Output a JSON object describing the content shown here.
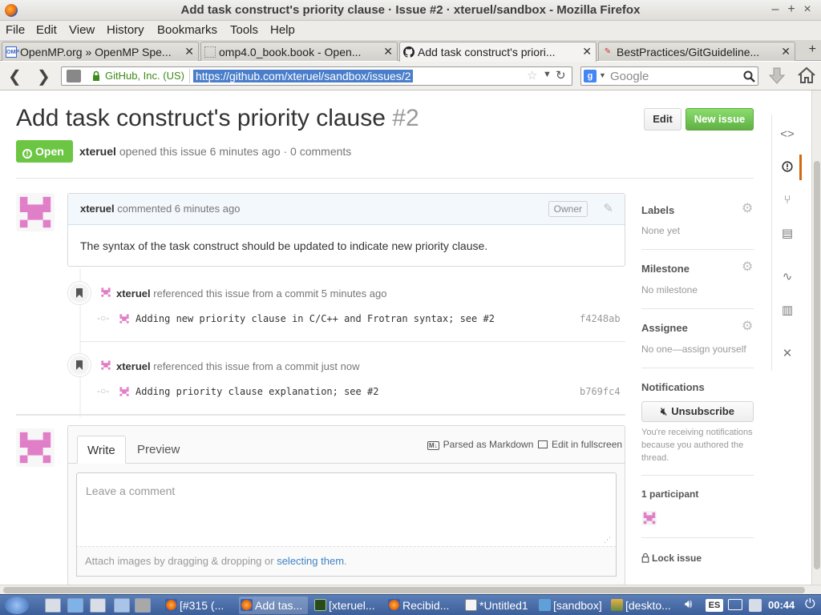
{
  "window": {
    "title": "Add task construct's priority clause · Issue #2 · xteruel/sandbox - Mozilla Firefox",
    "minimize": "–",
    "maximize": "+",
    "close": "×"
  },
  "menu": [
    "File",
    "Edit",
    "View",
    "History",
    "Bookmarks",
    "Tools",
    "Help"
  ],
  "tabs": [
    {
      "label": "OpenMP.org » OpenMP Spe...",
      "favicon": "OMP"
    },
    {
      "label": "omp4.0_book.book - Open...",
      "favicon": ""
    },
    {
      "label": "Add task construct's priori...",
      "favicon": "github"
    },
    {
      "label": "BestPractices/GitGuideline...",
      "favicon": ""
    }
  ],
  "newtab": "+",
  "nav": {
    "identity": "GitHub, Inc. (US)",
    "url": "https://github.com/xteruel/sandbox/issues/2",
    "search_engine": "g",
    "search_placeholder": "Google"
  },
  "issue": {
    "title": "Add task construct's priority clause",
    "number": "#2",
    "edit_label": "Edit",
    "new_issue_label": "New issue",
    "state": "Open",
    "author": "xteruel",
    "meta": "opened this issue 6 minutes ago · 0 comments"
  },
  "comment": {
    "author": "xteruel",
    "when": "commented 6 minutes ago",
    "badge": "Owner",
    "body": "The syntax of the task construct should be updated to indicate new priority clause."
  },
  "events": [
    {
      "author": "xteruel",
      "text": "referenced this issue from a commit 5 minutes ago",
      "commit_message": "Adding new priority clause in C/C++ and Frotran syntax; see #2",
      "sha": "f4248ab"
    },
    {
      "author": "xteruel",
      "text": "referenced this issue from a commit just now",
      "commit_message": "Adding priority clause explanation; see #2",
      "sha": "b769fc4"
    }
  ],
  "composer": {
    "tab_write": "Write",
    "tab_preview": "Preview",
    "markdown_hint": "Parsed as Markdown",
    "fullscreen": "Edit in fullscreen",
    "placeholder": "Leave a comment",
    "attach_text": "Attach images by dragging & dropping or ",
    "attach_link": "selecting them",
    "attach_end": "."
  },
  "sidebar": {
    "labels_title": "Labels",
    "labels_value": "None yet",
    "milestone_title": "Milestone",
    "milestone_value": "No milestone",
    "assignee_title": "Assignee",
    "assignee_value": "No one—assign yourself",
    "notifications_title": "Notifications",
    "unsubscribe_label": "Unsubscribe",
    "notify_line1": "You're receiving notifications",
    "notify_line2": "because you authored the",
    "notify_line3": "thread.",
    "participants_title": "1 participant",
    "lock_label": "Lock issue"
  },
  "taskbar": {
    "apps": [
      {
        "label": "[#315 (...",
        "icon": "firefox"
      },
      {
        "label": "Add tas...",
        "icon": "firefox"
      },
      {
        "label": "[xteruel...",
        "icon": "terminal"
      },
      {
        "label": "Recibid...",
        "icon": "firefox"
      },
      {
        "label": "*Untitled1",
        "icon": "editor"
      },
      {
        "label": "[sandbox]",
        "icon": "folder"
      },
      {
        "label": "[deskto...",
        "icon": "image"
      }
    ],
    "keyboard": "ES",
    "clock": "00:44"
  },
  "colors": {
    "open_green": "#6cc644",
    "link_blue": "#4183c4",
    "repo_nav_active": "#d26911",
    "avatar_pink": "#e07fc8"
  }
}
